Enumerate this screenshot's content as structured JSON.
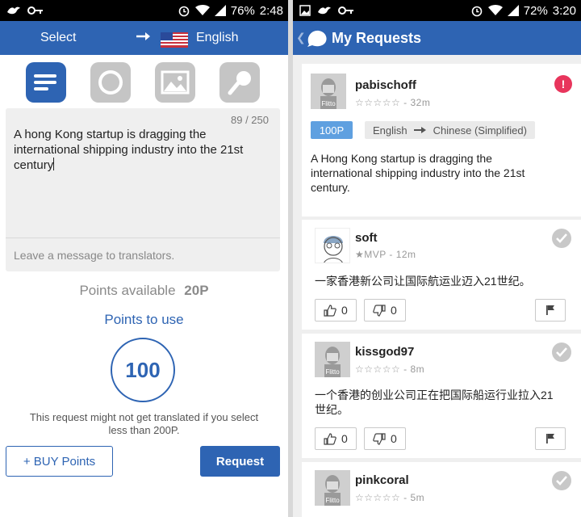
{
  "left": {
    "status": {
      "battery": "76%",
      "time": "2:48"
    },
    "header": {
      "select_label": "Select",
      "target_language": "English"
    },
    "modes": [
      {
        "name": "text-mode",
        "icon": "text-lines-icon",
        "active": true
      },
      {
        "name": "camera-mode",
        "icon": "camera-icon",
        "active": false
      },
      {
        "name": "image-mode",
        "icon": "image-icon",
        "active": false
      },
      {
        "name": "voice-mode",
        "icon": "microphone-icon",
        "active": false
      }
    ],
    "counter": "89 / 250",
    "source_text": "A hong Kong startup is dragging the international shipping industry into the 21st century",
    "message_placeholder": "Leave a message to translators.",
    "points_available_label": "Points available",
    "points_available_value": "20P",
    "points_to_use_label": "Points to use",
    "points_to_use_value": "100",
    "warning": "This request might not get translated if you select less than 200P.",
    "buy_label": "+ BUY Points",
    "request_label": "Request"
  },
  "right": {
    "status": {
      "battery": "72%",
      "time": "3:20"
    },
    "header": {
      "title": "My Requests"
    },
    "request": {
      "user": "pabischoff",
      "stars": "☆☆☆☆☆",
      "time": "- 32m",
      "alert": "!",
      "points": "100P",
      "lang_from": "English",
      "lang_to": "Chinese (Simplified)",
      "text": "A Hong Kong startup is dragging the international shipping industry into the 21st century."
    },
    "translations": [
      {
        "user": "soft",
        "meta": "★MVP - 12m",
        "text": "一家香港新公司让国际航运业迈入21世纪。",
        "up": "0",
        "down": "0"
      },
      {
        "user": "kissgod97",
        "meta": "☆☆☆☆☆ - 8m",
        "text": "一个香港的创业公司正在把国际船运行业拉入21世纪。",
        "up": "0",
        "down": "0"
      },
      {
        "user": "pinkcoral",
        "meta": "☆☆☆☆☆ - 5m"
      }
    ],
    "flitto_label": "Flitto"
  }
}
